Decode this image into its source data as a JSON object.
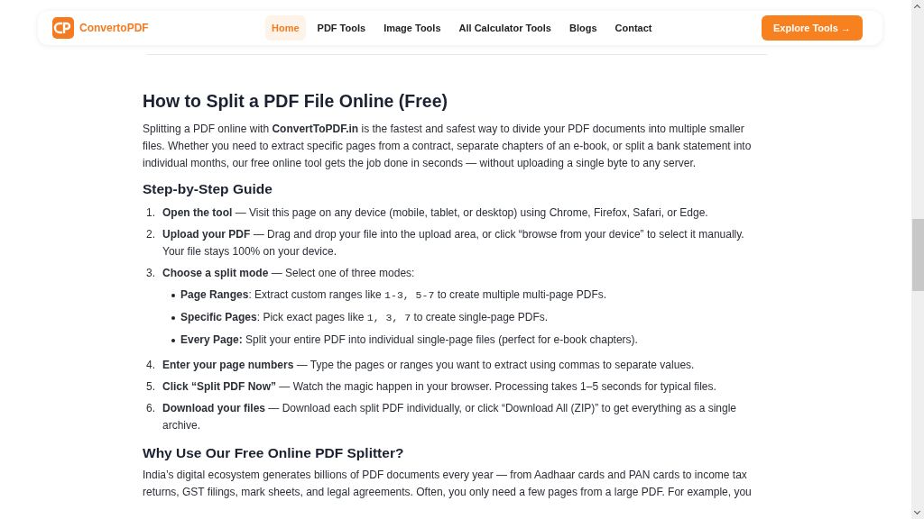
{
  "header": {
    "brand": "ConvertoPDF",
    "nav": [
      {
        "label": "Home",
        "selected": true
      },
      {
        "label": "PDF Tools",
        "selected": false
      },
      {
        "label": "Image Tools",
        "selected": false
      },
      {
        "label": "All Calculator Tools",
        "selected": false
      },
      {
        "label": "Blogs",
        "selected": false
      },
      {
        "label": "Contact",
        "selected": false
      }
    ],
    "cta": "Explore Tools →"
  },
  "article": {
    "title": "How to Split a PDF File Online (Free)",
    "intro": "Splitting a PDF online with **ConvertToPDF.in** is the fastest and safest way to divide your PDF documents into multiple smaller files. Whether you need to extract specific pages from a contract, separate chapters of an e-book, or split a bank statement into individual months, our free online tool gets the job done in seconds — without uploading a single byte to any server.",
    "guide_title": "Step-by-Step Guide",
    "steps": [
      {
        "number": "1.",
        "text": "**Open the tool** — Visit this page on any device (mobile, tablet, or desktop) using Chrome, Firefox, Safari, or Edge."
      },
      {
        "number": "2.",
        "text": "**Upload your PDF** — Drag and drop your file into the upload area, or click “browse from your device” to select it manually. Your file stays 100% on your device."
      },
      {
        "number": "3.",
        "text": "**Choose a split mode** — Select one of three modes:",
        "bullets": [
          [
            {
              "kind": "bold",
              "text": "Page Ranges"
            },
            {
              "kind": "plain",
              "text": ": Extract custom ranges like "
            },
            {
              "kind": "code",
              "text": "1-3, 5-7"
            },
            {
              "kind": "plain",
              "text": " to create multiple multi-page PDFs."
            }
          ],
          [
            {
              "kind": "bold",
              "text": "Specific Pages"
            },
            {
              "kind": "plain",
              "text": ": Pick exact pages like "
            },
            {
              "kind": "code",
              "text": "1, 3, 7"
            },
            {
              "kind": "plain",
              "text": " to create single-page PDFs."
            }
          ],
          [
            {
              "kind": "bold",
              "text": "Every Page:"
            },
            {
              "kind": "plain",
              "text": " Split your entire PDF into individual single-page files (perfect for e-book chapters)."
            }
          ]
        ]
      },
      {
        "number": "4.",
        "text": "**Enter your page numbers** — Type the pages or ranges you want to extract using commas to separate values."
      },
      {
        "number": "5.",
        "text": "**Click “Split PDF Now”** — Watch the magic happen in your browser. Processing takes 1–5 seconds for typical files."
      },
      {
        "number": "6.",
        "text": "**Download your files** — Download each split PDF individually, or click “Download All (ZIP)” to get everything as a single archive."
      }
    ],
    "why_title": "Why Use Our Free Online PDF Splitter?",
    "why_text": "India’s digital ecosystem generates billions of PDF documents every year — from Aadhaar cards and PAN cards to income tax returns, GST filings, mark sheets, and legal agreements. Often, you only need a few pages from a large PDF. For example, you"
  }
}
